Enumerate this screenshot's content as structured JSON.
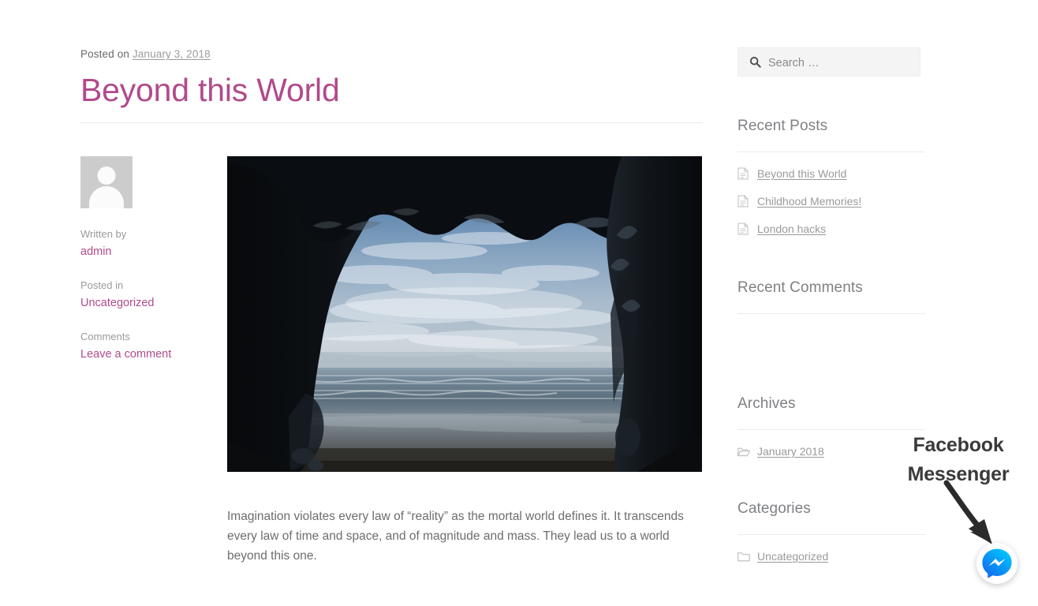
{
  "post": {
    "posted_on_prefix": "Posted on",
    "date": "January 3, 2018",
    "title": "Beyond this World",
    "body": "Imagination violates every law of “reality” as the mortal world defines it. It transcends every law of time and space, and of magnitude and mass. They lead us to a world beyond this one.",
    "featured_image_alt": "dark-cave-opening-to-ocean-beach-photo"
  },
  "meta": {
    "written_by_label": "Written by",
    "author": "admin",
    "posted_in_label": "Posted in",
    "category": "Uncategorized",
    "comments_label": "Comments",
    "comment_link": "Leave a comment"
  },
  "sidebar": {
    "search": {
      "placeholder": "Search …",
      "value": "",
      "icon": "search-icon"
    },
    "widgets": [
      {
        "id": "recent-posts",
        "title": "Recent Posts",
        "item_icon": "document-icon",
        "items": [
          {
            "label": "Beyond this World"
          },
          {
            "label": "Childhood Memories!"
          },
          {
            "label": "London hacks"
          }
        ]
      },
      {
        "id": "recent-comments",
        "title": "Recent Comments",
        "item_icon": "",
        "items": []
      },
      {
        "id": "archives",
        "title": "Archives",
        "item_icon": "folder-open-icon",
        "items": [
          {
            "label": "January 2018"
          }
        ]
      },
      {
        "id": "categories",
        "title": "Categories",
        "item_icon": "folder-icon",
        "items": [
          {
            "label": "Uncategorized"
          }
        ]
      }
    ]
  },
  "annotation": {
    "line1": "Facebook",
    "line2": "Messenger",
    "arrow_icon": "curved-arrow-down-right-icon",
    "button_icon": "facebook-messenger-icon"
  },
  "colors": {
    "title": "#b14a8b",
    "link": "#b14a8b",
    "body_text": "#6d6d6d",
    "muted_text": "#9a9a9a",
    "widget_title": "#7f8184",
    "rule": "#eceaea",
    "messenger_blue_light": "#00b2ff",
    "messenger_blue_dark": "#006aff",
    "annotation_text": "#3a3a3a"
  }
}
